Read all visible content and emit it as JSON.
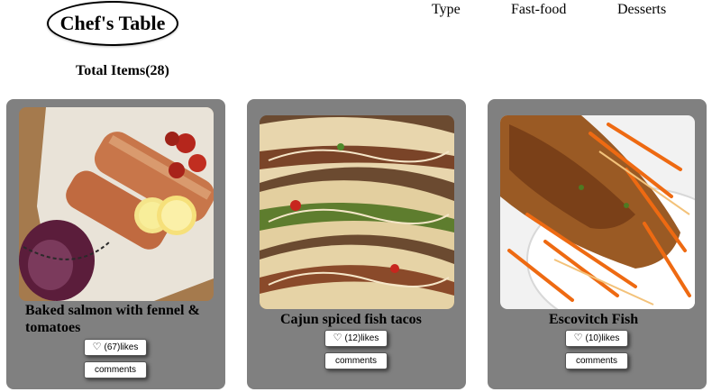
{
  "header": {
    "logo": "Chef's Table",
    "nav": [
      "Type",
      "Fast-food",
      "Desserts"
    ]
  },
  "summary": {
    "total_items": "Total Items(28)"
  },
  "icons": {
    "like": "heart-icon"
  },
  "colors": {
    "card_bg": "#808080"
  },
  "cards": [
    {
      "title": "Baked salmon with fennel & tomatoes",
      "likes": "(67)likes",
      "comments": "comments"
    },
    {
      "title": "Cajun spiced fish tacos",
      "likes": "(12)likes",
      "comments": "comments"
    },
    {
      "title": "Escovitch Fish",
      "likes": "(10)likes",
      "comments": "comments"
    }
  ]
}
